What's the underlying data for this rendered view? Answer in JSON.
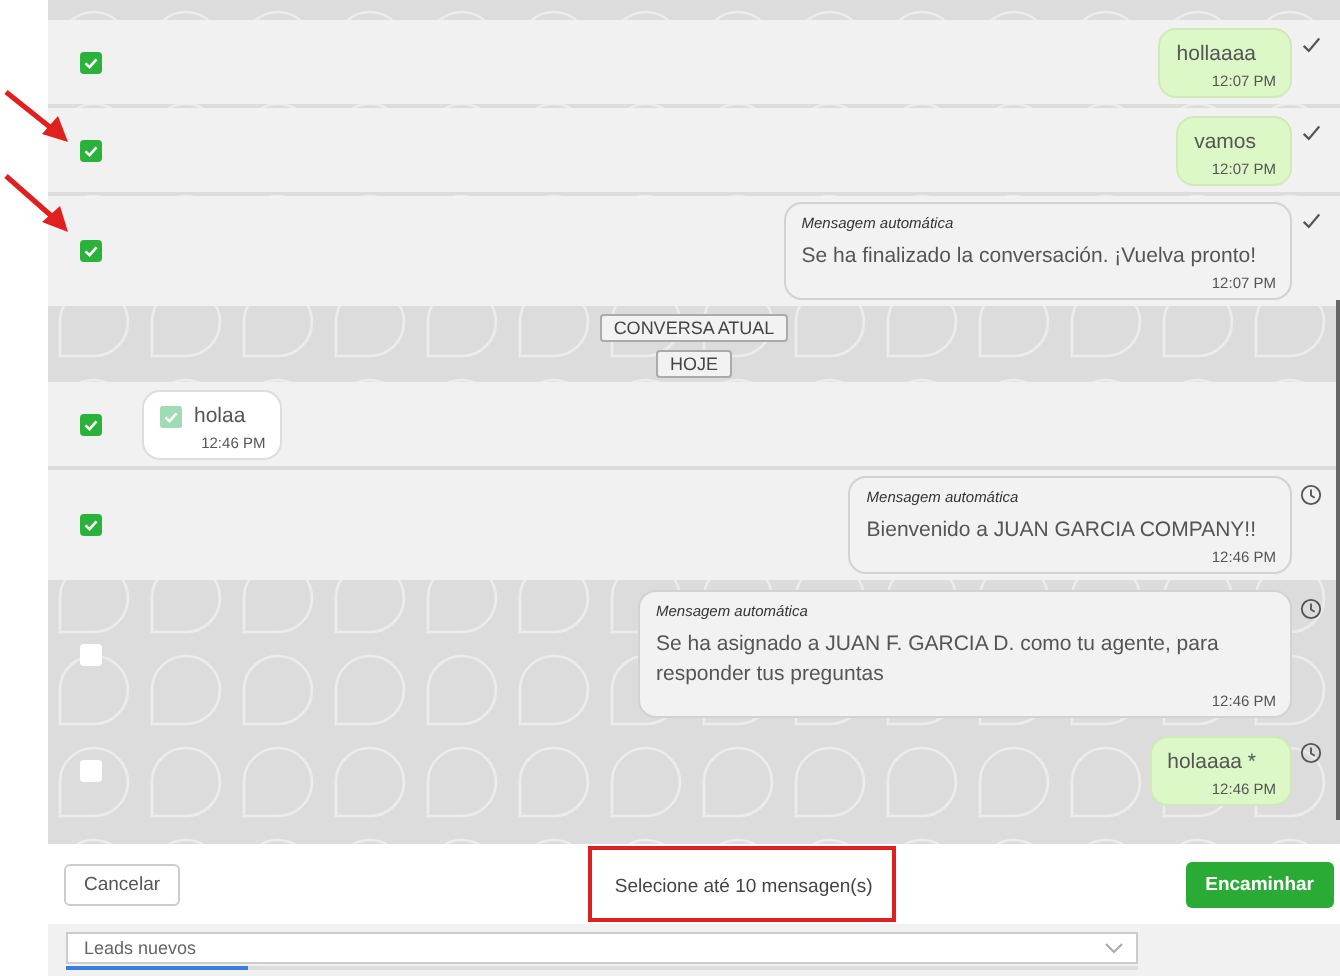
{
  "timeline": [
    {
      "kind": "outgoing",
      "checked": true,
      "text": "hollaaaa",
      "time": "12:07 PM",
      "delivered": true
    },
    {
      "kind": "outgoing",
      "checked": true,
      "text": "vamos",
      "time": "12:07 PM",
      "delivered": true
    },
    {
      "kind": "automatic",
      "checked": true,
      "label": "Mensagem automática",
      "text": "Se ha finalizado la conversación. ¡Vuelva pronto!",
      "time": "12:07 PM",
      "delivered": true
    },
    {
      "kind": "separator",
      "text": "CONVERSA ATUAL"
    },
    {
      "kind": "separator",
      "text": "HOJE"
    },
    {
      "kind": "incoming",
      "checked": true,
      "text": "holaa",
      "time": "12:46 PM"
    },
    {
      "kind": "automatic",
      "checked": true,
      "label": "Mensagem automática",
      "text": "Bienvenido a JUAN GARCIA COMPANY!!",
      "time": "12:46 PM",
      "delivered": false
    },
    {
      "kind": "automatic",
      "checked": false,
      "label": "Mensagem automática",
      "text": "Se ha asignado a JUAN F. GARCIA D. como tu agente, para responder tus preguntas",
      "time": "12:46 PM",
      "delivered": false
    },
    {
      "kind": "outgoing",
      "checked": false,
      "text": "holaaaa *",
      "time": "12:46 PM",
      "delivered": false
    }
  ],
  "footer": {
    "cancel": "Cancelar",
    "hint": "Selecione até 10 mensagen(s)",
    "forward": "Encaminhar"
  },
  "pipeline": {
    "value": "Leads nuevos",
    "level": 0.17
  }
}
